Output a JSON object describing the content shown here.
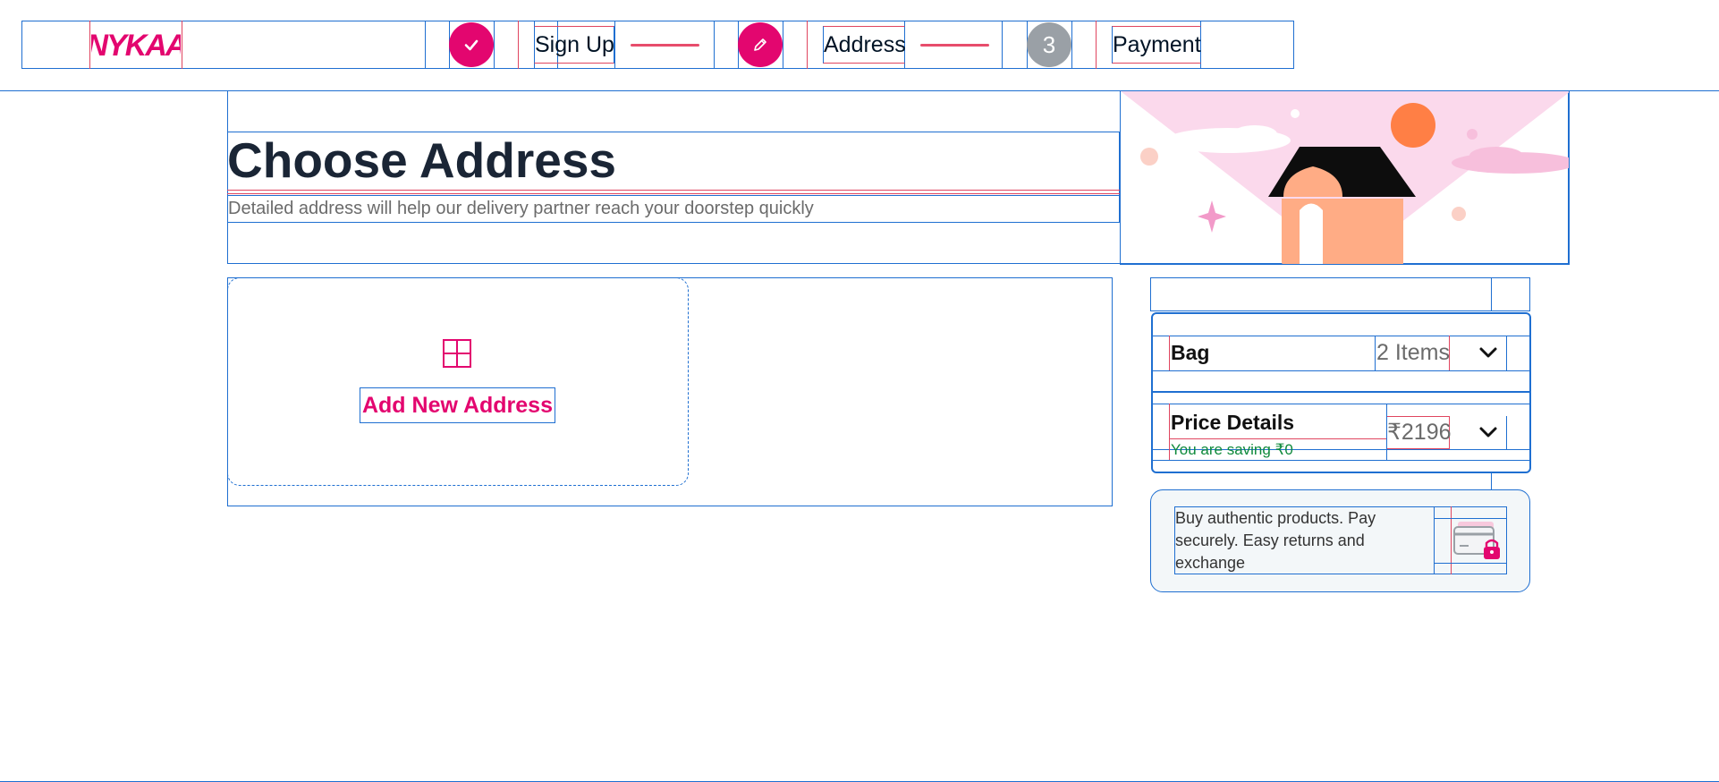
{
  "header": {
    "logo_text": "NYKAA",
    "steps": [
      {
        "label": "Sign Up",
        "state": "completed",
        "icon": "check-icon"
      },
      {
        "label": "Address",
        "state": "current",
        "icon": "pencil-icon"
      },
      {
        "label": "Payment",
        "state": "upcoming",
        "number": "3"
      }
    ]
  },
  "hero": {
    "title": "Choose Address",
    "subtitle": "Detailed address will help our delivery partner reach your doorstep quickly",
    "illustration": "house-illustration"
  },
  "address": {
    "add_label": "Add New Address",
    "add_icon": "plus-icon"
  },
  "summary": {
    "bag_label": "Bag",
    "bag_count": "2 Items",
    "price_label": "Price Details",
    "price_value": "₹2196",
    "saving_text": "You are saving ₹0"
  },
  "trust": {
    "text": "Buy authentic products. Pay securely. Easy returns and exchange",
    "icon": "secure-card-icon"
  },
  "colors": {
    "brand_pink": "#e3066f",
    "step_pending": "#9aa0a6",
    "saving_green": "#0e8a3b",
    "title_dark": "#1a2535"
  }
}
